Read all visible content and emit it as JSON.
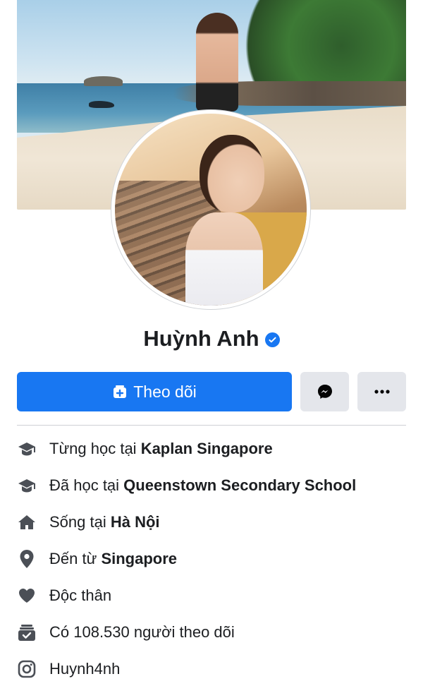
{
  "profile": {
    "name": "Huỳnh Anh",
    "verified": true
  },
  "actions": {
    "follow_label": "Theo dõi",
    "messenger_icon": "messenger-icon",
    "more_icon": "more-icon"
  },
  "details": [
    {
      "icon": "graduation-cap-icon",
      "prefix": "Từng học tại ",
      "bold": "Kaplan Singapore"
    },
    {
      "icon": "graduation-cap-icon",
      "prefix": "Đã học tại ",
      "bold": "Queenstown Secondary School"
    },
    {
      "icon": "home-icon",
      "prefix": "Sống tại ",
      "bold": "Hà Nội"
    },
    {
      "icon": "location-pin-icon",
      "prefix": "Đến từ ",
      "bold": "Singapore"
    },
    {
      "icon": "heart-icon",
      "prefix": "Độc thân",
      "bold": ""
    },
    {
      "icon": "followers-icon",
      "prefix": "Có 108.530 người theo dõi",
      "bold": ""
    },
    {
      "icon": "instagram-icon",
      "prefix": "Huynh4nh",
      "bold": ""
    }
  ],
  "colors": {
    "accent": "#1877f2",
    "button_gray": "#e4e6eb",
    "text": "#1c1e21",
    "icon": "#4b4f56"
  }
}
